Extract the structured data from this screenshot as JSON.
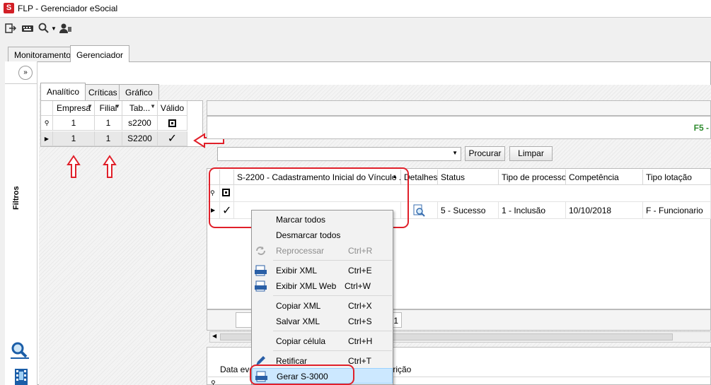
{
  "window": {
    "title": "FLP - Gerenciador eSocial",
    "logo_text": "S"
  },
  "toolbar": {
    "icons": [
      "exit-icon",
      "keyboard-icon",
      "search-icon",
      "user-icon"
    ]
  },
  "outer_tabs": [
    {
      "label": "Monitoramento",
      "active": false
    },
    {
      "label": "Gerenciador",
      "active": true
    }
  ],
  "filtros": {
    "label": "Filtros",
    "collapse_glyph": "»"
  },
  "inner_tabs": [
    {
      "label": "Analítico",
      "active": true
    },
    {
      "label": "Críticas",
      "active": false
    },
    {
      "label": "Gráfico",
      "active": false
    }
  ],
  "left_grid": {
    "headers": [
      "Empresa",
      "Filial",
      "Tab...",
      "Válido"
    ],
    "rows": [
      {
        "empresa": "1",
        "filial": "1",
        "tabela": "s2200",
        "valido": "square"
      },
      {
        "empresa": "1",
        "filial": "1",
        "tabela": "S2200",
        "valido": "check"
      }
    ]
  },
  "status_bar": {
    "f5_text": "F5 -"
  },
  "search": {
    "select_value": "",
    "search_label": "Procurar",
    "clear_label": "Limpar"
  },
  "main_grid": {
    "headers": [
      "S-2200 - Cadastramento Inicial do Vínculo ...",
      "Detalhes",
      "Status",
      "Tipo de processo",
      "Competência",
      "Tipo lotação"
    ],
    "row": {
      "status": "5 - Sucesso",
      "tipo_processo": "1 - Inclusão",
      "competencia": "10/10/2018",
      "tipo_lotacao": "F - Funcionario"
    }
  },
  "pager": {
    "page": "1"
  },
  "bottom_grid": {
    "headers": [
      "Data eve",
      "trição"
    ]
  },
  "context_menu": {
    "items": [
      {
        "label": "Marcar todos",
        "shortcut": "",
        "disabled": false
      },
      {
        "label": "Desmarcar todos",
        "shortcut": "",
        "disabled": false
      },
      {
        "label": "Reprocessar",
        "shortcut": "Ctrl+R",
        "disabled": true
      },
      {
        "label": "Exibir XML",
        "shortcut": "Ctrl+E",
        "disabled": false
      },
      {
        "label": "Exibir XML Web",
        "shortcut": "Ctrl+W",
        "disabled": false
      },
      {
        "label": "Copiar XML",
        "shortcut": "Ctrl+X",
        "disabled": false
      },
      {
        "label": "Salvar XML",
        "shortcut": "Ctrl+S",
        "disabled": false
      },
      {
        "label": "Copiar célula",
        "shortcut": "Ctrl+H",
        "disabled": false
      },
      {
        "label": "Retificar",
        "shortcut": "Ctrl+T",
        "disabled": false
      },
      {
        "label": "Gerar S-3000",
        "shortcut": "",
        "disabled": false,
        "highlighted": true
      }
    ]
  },
  "colors": {
    "annotation_red": "#e0202a",
    "menu_highlight": "#cce8ff",
    "f5_green": "#2e8b2e"
  }
}
